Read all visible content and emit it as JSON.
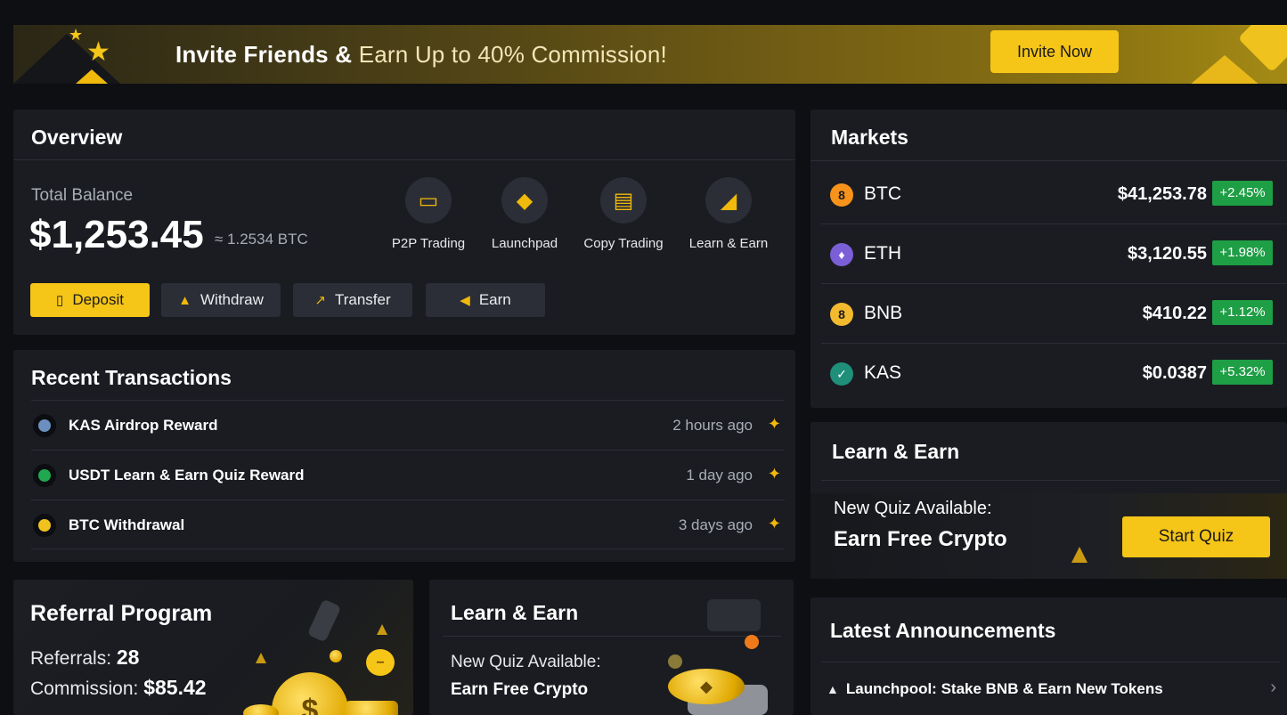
{
  "banner": {
    "title_bold": "Invite Friends &",
    "title_light": "Earn Up to 40% Commission!",
    "cta": "Invite Now"
  },
  "overview": {
    "title": "Overview",
    "balance_label": "Total Balance",
    "balance": "$1,253.45",
    "balance_btc": "≈ 1.2534 BTC",
    "quick_actions": [
      {
        "label": "P2P Trading",
        "icon": "wallet-icon"
      },
      {
        "label": "Launchpad",
        "icon": "rocket-icon"
      },
      {
        "label": "Copy Trading",
        "icon": "copy-icon"
      },
      {
        "label": "Learn & Earn",
        "icon": "book-icon"
      }
    ],
    "buttons": {
      "deposit": "Deposit",
      "withdraw": "Withdraw",
      "transfer": "Transfer",
      "earn": "Earn"
    }
  },
  "transactions": {
    "title": "Recent Transactions",
    "items": [
      {
        "name": "KAS Airdrop Reward",
        "time": "2 hours ago",
        "color": "#6b8fbf"
      },
      {
        "name": "USDT Learn & Earn Quiz Reward",
        "time": "1 day ago",
        "color": "#1fa84f"
      },
      {
        "name": "BTC Withdrawal",
        "time": "3 days ago",
        "color": "#f0c21d"
      }
    ]
  },
  "markets": {
    "title": "Markets",
    "items": [
      {
        "symbol": "BTC",
        "price": "$41,253.78",
        "change": "+2.45%",
        "icon_color": "#f7931a",
        "glyph": "8"
      },
      {
        "symbol": "ETH",
        "price": "$3,120.55",
        "change": "+1.98%",
        "icon_color": "#7b5fd6",
        "glyph": "♦"
      },
      {
        "symbol": "BNB",
        "price": "$410.22",
        "change": "+1.12%",
        "icon_color": "#f3ba2f",
        "glyph": "8"
      },
      {
        "symbol": "KAS",
        "price": "$0.0387",
        "change": "+5.32%",
        "icon_color": "#1f8f7a",
        "glyph": "✓"
      }
    ]
  },
  "learn_right": {
    "title": "Learn & Earn",
    "sub": "New Quiz Available:",
    "headline": "Earn Free Crypto",
    "cta": "Start Quiz"
  },
  "referral": {
    "title": "Referral Program",
    "referrals_label": "Referrals:",
    "referrals_value": "28",
    "commission_label": "Commission:",
    "commission_value": "$85.42"
  },
  "learn_mid": {
    "title": "Learn & Earn",
    "sub": "New Quiz Available:",
    "headline": "Earn Free Crypto"
  },
  "announcements": {
    "title": "Latest Announcements",
    "items": [
      {
        "text": "Launchpool: Stake BNB & Earn New Tokens"
      }
    ]
  }
}
